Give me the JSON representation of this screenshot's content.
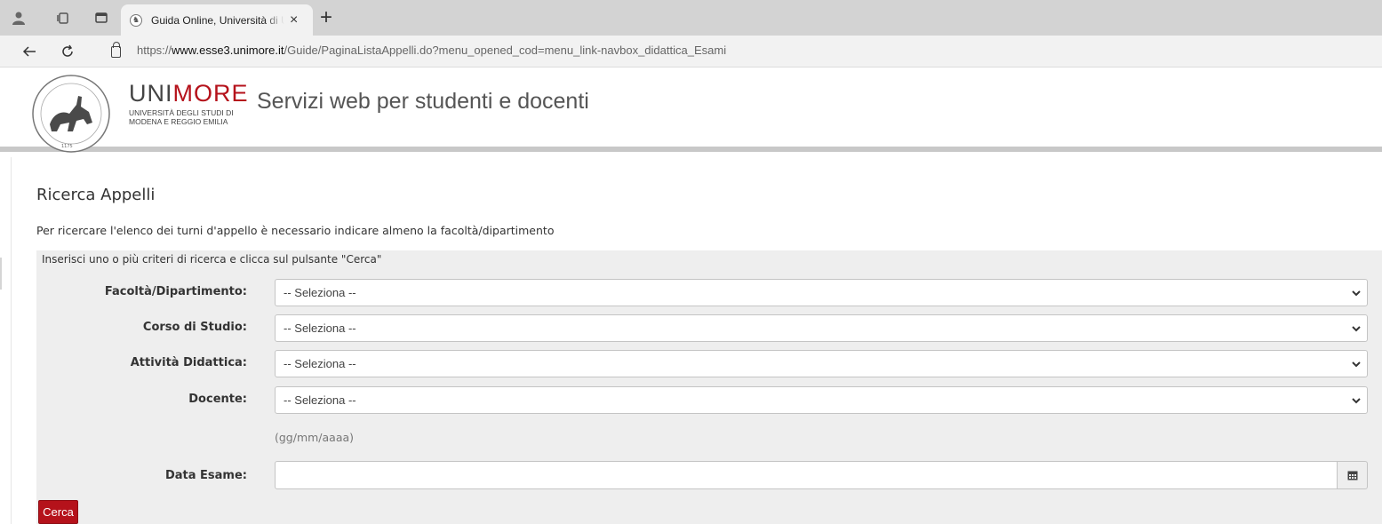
{
  "browser": {
    "tab_title": "Guida Online, Università di UNIMORE",
    "tab_close": "×",
    "new_tab": "+",
    "url_prefix": "https://",
    "url_host": "www.esse3.unimore.it",
    "url_path": "/Guide/PaginaListaAppelli.do?menu_opened_cod=menu_link-navbox_didattica_Esami"
  },
  "header": {
    "brand_name_a": "UNI",
    "brand_name_b": "MORE",
    "brand_sub_1": "UNIVERSITÀ DEGLI STUDI DI",
    "brand_sub_2": "MODENA E REGGIO EMILIA",
    "site_title": "Servizi web per studenti e docenti",
    "seal_year": "1175",
    "accent_color": "#b5121b"
  },
  "main": {
    "title": "Ricerca Appelli",
    "instruction": "Per ricercare l'elenco dei turni d'appello è necessario indicare almeno la facoltà/dipartimento",
    "panel_hint": "Inserisci uno o più criteri di ricerca e clicca sul pulsante \"Cerca\"",
    "fields": [
      {
        "label": "Facoltà/Dipartimento:",
        "value": "-- Seleziona --"
      },
      {
        "label": "Corso di Studio:",
        "value": "-- Seleziona --"
      },
      {
        "label": "Attività Didattica:",
        "value": "-- Seleziona --"
      },
      {
        "label": "Docente:",
        "value": "-- Seleziona --"
      }
    ],
    "date_hint": "(gg/mm/aaaa)",
    "date_label": "Data Esame:",
    "date_value": "",
    "submit_label": "Cerca"
  }
}
